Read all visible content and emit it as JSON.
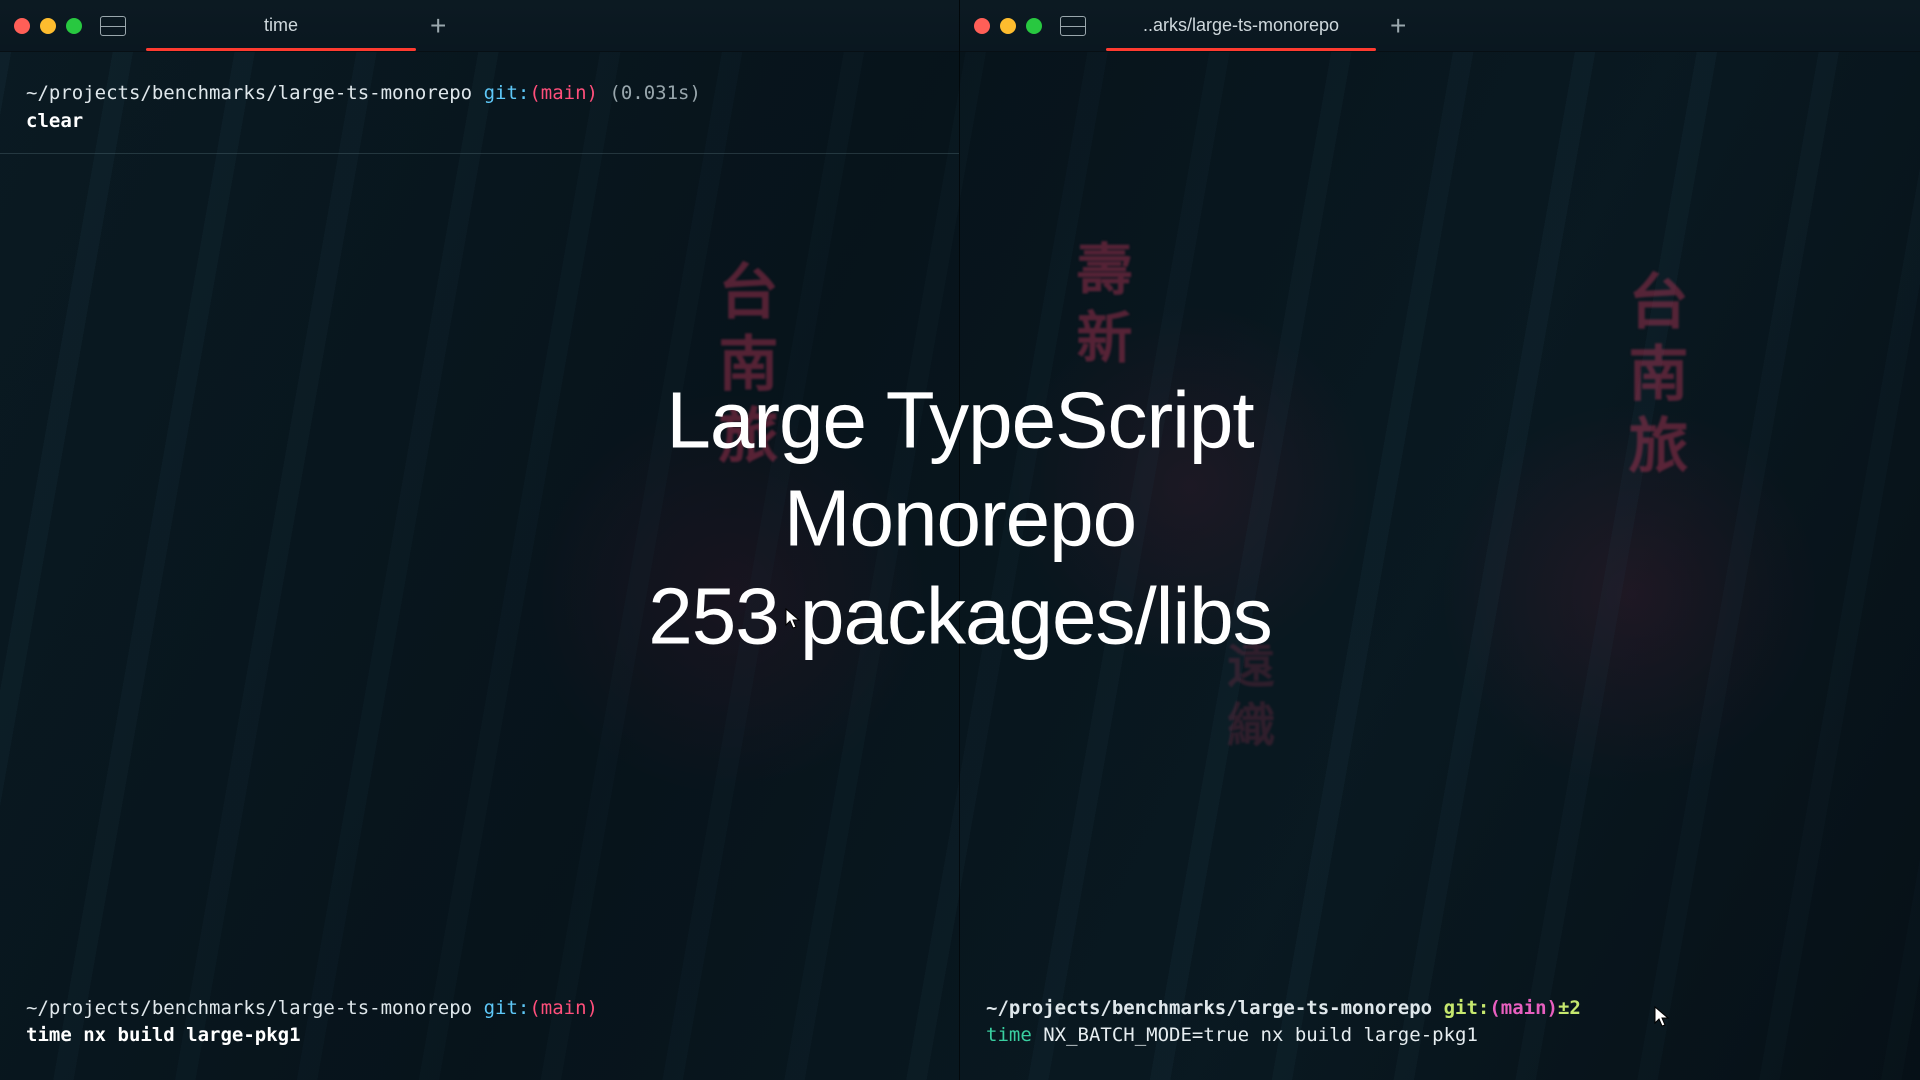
{
  "overlay": {
    "line1": "Large TypeScript",
    "line2": "Monorepo",
    "line3": "253 packages/libs"
  },
  "left": {
    "tab_title": "time",
    "top": {
      "path": "~/projects/benchmarks/large-ts-monorepo",
      "git_label": " git:",
      "branch": "(main)",
      "timing": " (0.031s)",
      "cmd": "clear"
    },
    "bottom": {
      "path": "~/projects/benchmarks/large-ts-monorepo",
      "git_label": " git:",
      "branch": "(main)",
      "cmd_time": "time ",
      "cmd_rest": "nx build large-pkg1"
    }
  },
  "right": {
    "tab_title": "..arks/large-ts-monorepo",
    "bottom": {
      "path": "~/projects/benchmarks/large-ts-monorepo",
      "git_label": " git:",
      "branch": "(main)",
      "dirty": "±2",
      "cmd_time": "time ",
      "cmd_rest": "NX_BATCH_MODE=true nx build large-pkg1"
    }
  },
  "colors": {
    "accent_red": "#ff3b30",
    "neon_pink": "#e85fbf",
    "cyan": "#5ec8f8",
    "green": "#39cfa0",
    "lime": "#c6e86e"
  }
}
